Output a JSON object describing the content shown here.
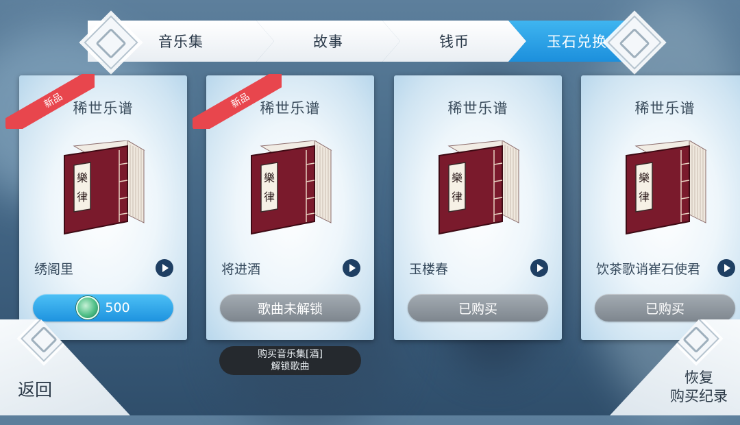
{
  "tabs": [
    {
      "label": "音乐集",
      "active": false
    },
    {
      "label": "故事",
      "active": false
    },
    {
      "label": "钱币",
      "active": false
    },
    {
      "label": "玉石兑换",
      "active": true
    }
  ],
  "cards": [
    {
      "badge": "新品",
      "title": "稀世乐谱",
      "book_text": "樂律",
      "song": "绣阁里",
      "button_label": "500",
      "button_type": "price",
      "currency_icon": "jade-coin-icon"
    },
    {
      "badge": "新品",
      "title": "稀世乐谱",
      "book_text": "樂律",
      "song": "将进酒",
      "button_label": "歌曲未解锁",
      "button_type": "locked"
    },
    {
      "badge": "",
      "title": "稀世乐谱",
      "book_text": "樂律",
      "song": "玉楼春",
      "button_label": "已购买",
      "button_type": "purchased"
    },
    {
      "badge": "",
      "title": "稀世乐谱",
      "book_text": "樂律",
      "song": "饮茶歌诮崔石使君",
      "button_label": "已购买",
      "button_type": "purchased"
    }
  ],
  "tooltip": {
    "line1": "购买音乐集[酒]",
    "line2": "解锁歌曲"
  },
  "footer": {
    "back_label": "返回",
    "restore_line1": "恢复",
    "restore_line2": "购买纪录"
  },
  "colors": {
    "active_tab": "#2ba4ea",
    "badge": "#e8464d",
    "book": "#7a1a2c",
    "button_blue": "#2ba4ea",
    "button_gray": "#8c949b"
  }
}
